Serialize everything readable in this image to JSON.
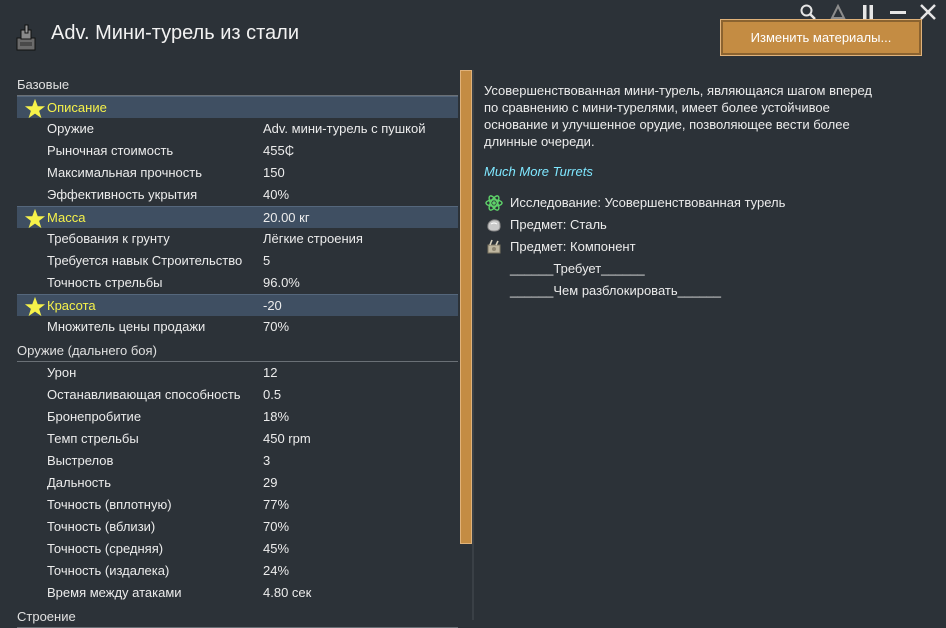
{
  "window": {
    "title": "Adv. Мини-турель из стали",
    "change_materials_label": "Изменить материалы...",
    "controls": [
      {
        "name": "search-icon",
        "glyph": "⚲"
      },
      {
        "name": "delta-icon",
        "glyph": "Δ"
      },
      {
        "name": "pause-icon",
        "glyph": "❚❚"
      },
      {
        "name": "minimize-icon",
        "glyph": "▬"
      },
      {
        "name": "close-icon",
        "glyph": "✕"
      }
    ]
  },
  "stats": {
    "sections": [
      {
        "header": "Базовые",
        "rows": [
          {
            "label": "Описание",
            "value": "",
            "starred": true
          },
          {
            "label": "Оружие",
            "value": "Adv. мини-турель с пушкой",
            "starred": false
          },
          {
            "label": "Рыночная стоимость",
            "value": "455₵",
            "starred": false
          },
          {
            "label": "Максимальная прочность",
            "value": "150",
            "starred": false
          },
          {
            "label": "Эффективность укрытия",
            "value": "40%",
            "starred": false
          },
          {
            "label": "Масса",
            "value": "20.00 кг",
            "starred": true
          },
          {
            "label": "Требования к грунту",
            "value": "Лёгкие строения",
            "starred": false
          },
          {
            "label": "Требуется навык Строительство",
            "value": "5",
            "starred": false
          },
          {
            "label": "Точность стрельбы",
            "value": "96.0%",
            "starred": false
          },
          {
            "label": "Красота",
            "value": "-20",
            "starred": true
          },
          {
            "label": "Множитель цены продажи",
            "value": "70%",
            "starred": false
          }
        ]
      },
      {
        "header": "Оружие (дальнего боя)",
        "rows": [
          {
            "label": "Урон",
            "value": "12",
            "starred": false
          },
          {
            "label": "Останавливающая способность",
            "value": "0.5",
            "starred": false
          },
          {
            "label": "Бронепробитие",
            "value": "18%",
            "starred": false
          },
          {
            "label": "Темп стрельбы",
            "value": "450 rpm",
            "starred": false
          },
          {
            "label": "Выстрелов",
            "value": "3",
            "starred": false
          },
          {
            "label": "Дальность",
            "value": "29",
            "starred": false
          },
          {
            "label": "Точность (вплотную)",
            "value": "77%",
            "starred": false
          },
          {
            "label": "Точность (вблизи)",
            "value": "70%",
            "starred": false
          },
          {
            "label": "Точность (средняя)",
            "value": "45%",
            "starred": false
          },
          {
            "label": "Точность (издалека)",
            "value": "24%",
            "starred": false
          },
          {
            "label": "Время между атаками",
            "value": "4.80 сек",
            "starred": false
          }
        ]
      },
      {
        "header": "Строение",
        "rows": []
      }
    ]
  },
  "detail": {
    "description": "Усовершенствованная мини-турель, являющаяся шагом вперед по сравнению с мини-турелями, имеет более устойчивое основание и улучшенное орудие, позволяющее вести более длинные очереди.",
    "mod_name": "Much More Turrets",
    "requirements": [
      {
        "icon": "research-atom-icon",
        "text": "Исследование: Усовершенствованная турель"
      },
      {
        "icon": "steel-item-icon",
        "text": "Предмет: Сталь"
      },
      {
        "icon": "component-item-icon",
        "text": "Предмет: Компонент"
      }
    ],
    "requires_line": "______Требует______",
    "unlocks_line": "______Чем разблокировать______"
  },
  "colors": {
    "background": "#2c3238",
    "highlight_row": "#3f4f62",
    "highlight_text": "#f6f24a",
    "accent_button": "#c48c43",
    "mod_text": "#7fe7ff"
  }
}
